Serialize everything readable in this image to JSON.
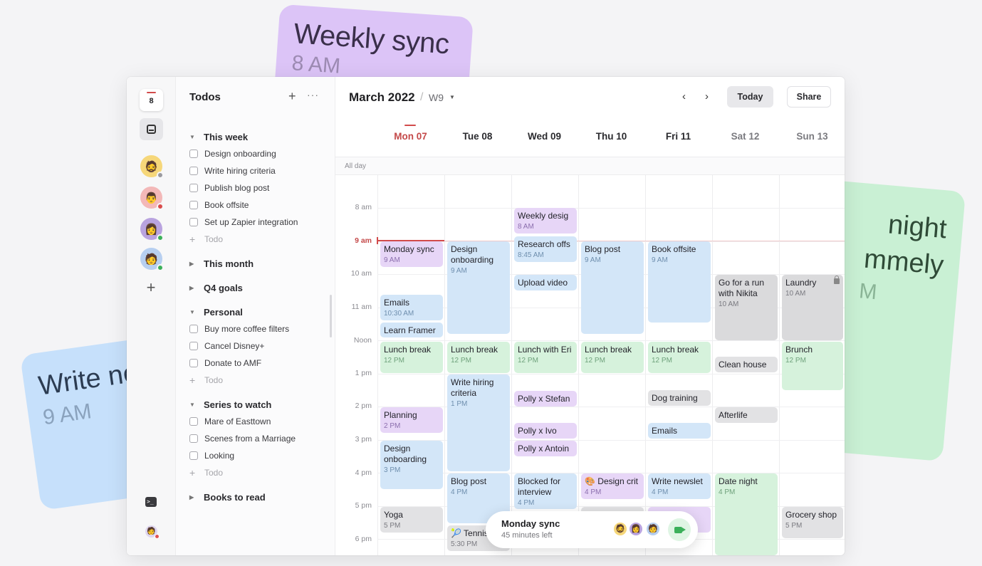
{
  "floating": {
    "weekly": {
      "title": "Weekly sync",
      "time": "8 AM"
    },
    "write": {
      "title": "Write ne",
      "time": "9 AM"
    },
    "date_night": {
      "title_line1": "night",
      "title_line2": "mmely",
      "time": "M"
    }
  },
  "rail": {
    "date_number": "8"
  },
  "todos": {
    "title": "Todos",
    "add_icon": "+",
    "more_icon": "···",
    "this_week": {
      "label": "This week",
      "items": [
        "Design onboarding",
        "Write hiring criteria",
        "Publish blog post",
        "Book offsite",
        "Set up Zapier integration"
      ],
      "add": "Todo"
    },
    "this_month": {
      "label": "This month"
    },
    "q4_goals": {
      "label": "Q4 goals"
    },
    "personal": {
      "label": "Personal",
      "items": [
        "Buy more coffee filters",
        "Cancel Disney+",
        "Donate to AMF"
      ],
      "add": "Todo"
    },
    "series": {
      "label": "Series to watch",
      "items": [
        "Mare of Easttown",
        "Scenes from a Marriage",
        "Looking"
      ],
      "add": "Todo"
    },
    "books": {
      "label": "Books to read"
    }
  },
  "calendar": {
    "month": "March 2022",
    "separator": "/",
    "week": "W9",
    "today_button": "Today",
    "share_button": "Share",
    "all_day": "All day",
    "days": [
      "Mon 07",
      "Tue 08",
      "Wed 09",
      "Thu 10",
      "Fri 11",
      "Sat 12",
      "Sun 13"
    ],
    "hours": [
      "8 am",
      "9 am",
      "10 am",
      "11 am",
      "Noon",
      "1 pm",
      "2 pm",
      "3 pm",
      "4 pm",
      "5 pm",
      "6 pm"
    ]
  },
  "events": {
    "mon_sync": {
      "title": "Monday sync",
      "time": "9 AM"
    },
    "mon_emails": {
      "title": "Emails",
      "time": "10:30 AM"
    },
    "mon_framer": {
      "title": "Learn Framer"
    },
    "mon_lunch": {
      "title": "Lunch break",
      "time": "12 PM"
    },
    "mon_planning": {
      "title": "Planning",
      "time": "2 PM"
    },
    "mon_design": {
      "title": "Design onboarding",
      "time": "3 PM"
    },
    "mon_yoga": {
      "title": "Yoga",
      "time": "5 PM"
    },
    "tue_design": {
      "title": "Design onboarding",
      "time": "9 AM"
    },
    "tue_lunch": {
      "title": "Lunch break",
      "time": "12 PM"
    },
    "tue_hiring": {
      "title": "Write hiring criteria",
      "time": "1 PM"
    },
    "tue_blog": {
      "title": "Blog post",
      "time": "4 PM"
    },
    "tue_tennis": {
      "title": "🎾 Tennis",
      "time": "5:30 PM"
    },
    "wed_weekly": {
      "title": "Weekly desig",
      "time": "8 AM"
    },
    "wed_research": {
      "title": "Research offs",
      "time": "8:45 AM"
    },
    "wed_upload": {
      "title": "Upload video"
    },
    "wed_lunch": {
      "title": "Lunch with Eri",
      "time": "12 PM"
    },
    "wed_stefan": {
      "title": "Polly x Stefan"
    },
    "wed_ivo": {
      "title": "Polly x Ivo"
    },
    "wed_antoin": {
      "title": "Polly x Antoin"
    },
    "wed_blocked": {
      "title": "Blocked for interview",
      "time": "4 PM"
    },
    "thu_blog": {
      "title": "Blog post",
      "time": "9 AM"
    },
    "thu_lunch": {
      "title": "Lunch break",
      "time": "12 PM"
    },
    "thu_crit": {
      "title": "🎨 Design crit",
      "time": "4 PM"
    },
    "fri_offsite": {
      "title": "Book offsite",
      "time": "9 AM"
    },
    "fri_lunch": {
      "title": "Lunch break",
      "time": "12 PM"
    },
    "fri_dog": {
      "title": "Dog training"
    },
    "fri_emails": {
      "title": "Emails"
    },
    "fri_newsletter": {
      "title": "Write newslet",
      "time": "4 PM"
    },
    "sat_run": {
      "title": "Go for a run with Nikita",
      "time": "10 AM"
    },
    "sat_clean": {
      "title": "Clean house"
    },
    "sat_afterlife": {
      "title": "Afterlife"
    },
    "sat_date": {
      "title": "Date night",
      "time": "4 PM"
    },
    "sun_laundry": {
      "title": "Laundry",
      "time": "10 AM"
    },
    "sun_brunch": {
      "title": "Brunch",
      "time": "12 PM"
    },
    "sun_grocery": {
      "title": "Grocery shop",
      "time": "5 PM"
    }
  },
  "toast": {
    "title": "Monday sync",
    "subtitle": "45 minutes left"
  },
  "colors": {
    "accent_red": "#d24b4b",
    "purple": "#e7d6f7",
    "blue": "#d3e6f8",
    "green": "#d6f2dc",
    "gray": "#e2e2e4"
  }
}
